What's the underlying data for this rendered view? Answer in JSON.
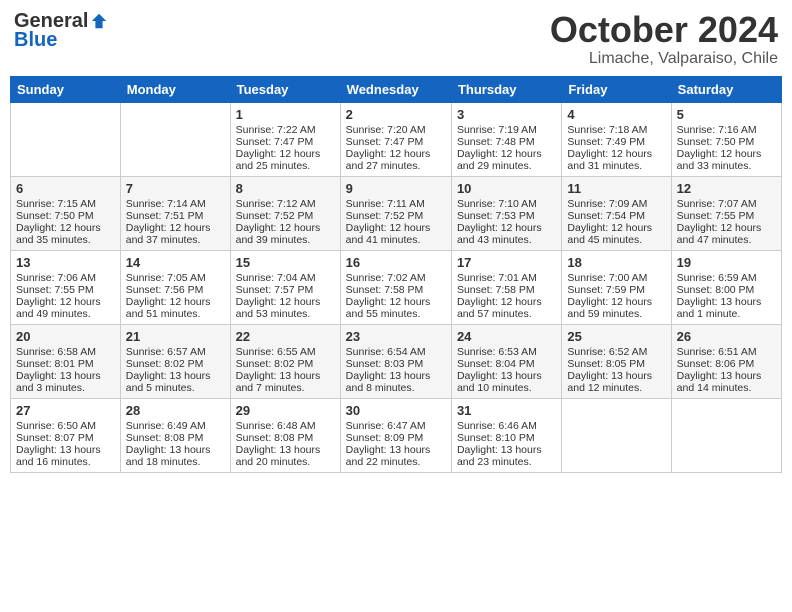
{
  "header": {
    "logo_general": "General",
    "logo_blue": "Blue",
    "title": "October 2024",
    "subtitle": "Limache, Valparaiso, Chile"
  },
  "days_of_week": [
    "Sunday",
    "Monday",
    "Tuesday",
    "Wednesday",
    "Thursday",
    "Friday",
    "Saturday"
  ],
  "weeks": [
    [
      {
        "day": "",
        "sunrise": "",
        "sunset": "",
        "daylight": ""
      },
      {
        "day": "",
        "sunrise": "",
        "sunset": "",
        "daylight": ""
      },
      {
        "day": "1",
        "sunrise": "Sunrise: 7:22 AM",
        "sunset": "Sunset: 7:47 PM",
        "daylight": "Daylight: 12 hours and 25 minutes."
      },
      {
        "day": "2",
        "sunrise": "Sunrise: 7:20 AM",
        "sunset": "Sunset: 7:47 PM",
        "daylight": "Daylight: 12 hours and 27 minutes."
      },
      {
        "day": "3",
        "sunrise": "Sunrise: 7:19 AM",
        "sunset": "Sunset: 7:48 PM",
        "daylight": "Daylight: 12 hours and 29 minutes."
      },
      {
        "day": "4",
        "sunrise": "Sunrise: 7:18 AM",
        "sunset": "Sunset: 7:49 PM",
        "daylight": "Daylight: 12 hours and 31 minutes."
      },
      {
        "day": "5",
        "sunrise": "Sunrise: 7:16 AM",
        "sunset": "Sunset: 7:50 PM",
        "daylight": "Daylight: 12 hours and 33 minutes."
      }
    ],
    [
      {
        "day": "6",
        "sunrise": "Sunrise: 7:15 AM",
        "sunset": "Sunset: 7:50 PM",
        "daylight": "Daylight: 12 hours and 35 minutes."
      },
      {
        "day": "7",
        "sunrise": "Sunrise: 7:14 AM",
        "sunset": "Sunset: 7:51 PM",
        "daylight": "Daylight: 12 hours and 37 minutes."
      },
      {
        "day": "8",
        "sunrise": "Sunrise: 7:12 AM",
        "sunset": "Sunset: 7:52 PM",
        "daylight": "Daylight: 12 hours and 39 minutes."
      },
      {
        "day": "9",
        "sunrise": "Sunrise: 7:11 AM",
        "sunset": "Sunset: 7:52 PM",
        "daylight": "Daylight: 12 hours and 41 minutes."
      },
      {
        "day": "10",
        "sunrise": "Sunrise: 7:10 AM",
        "sunset": "Sunset: 7:53 PM",
        "daylight": "Daylight: 12 hours and 43 minutes."
      },
      {
        "day": "11",
        "sunrise": "Sunrise: 7:09 AM",
        "sunset": "Sunset: 7:54 PM",
        "daylight": "Daylight: 12 hours and 45 minutes."
      },
      {
        "day": "12",
        "sunrise": "Sunrise: 7:07 AM",
        "sunset": "Sunset: 7:55 PM",
        "daylight": "Daylight: 12 hours and 47 minutes."
      }
    ],
    [
      {
        "day": "13",
        "sunrise": "Sunrise: 7:06 AM",
        "sunset": "Sunset: 7:55 PM",
        "daylight": "Daylight: 12 hours and 49 minutes."
      },
      {
        "day": "14",
        "sunrise": "Sunrise: 7:05 AM",
        "sunset": "Sunset: 7:56 PM",
        "daylight": "Daylight: 12 hours and 51 minutes."
      },
      {
        "day": "15",
        "sunrise": "Sunrise: 7:04 AM",
        "sunset": "Sunset: 7:57 PM",
        "daylight": "Daylight: 12 hours and 53 minutes."
      },
      {
        "day": "16",
        "sunrise": "Sunrise: 7:02 AM",
        "sunset": "Sunset: 7:58 PM",
        "daylight": "Daylight: 12 hours and 55 minutes."
      },
      {
        "day": "17",
        "sunrise": "Sunrise: 7:01 AM",
        "sunset": "Sunset: 7:58 PM",
        "daylight": "Daylight: 12 hours and 57 minutes."
      },
      {
        "day": "18",
        "sunrise": "Sunrise: 7:00 AM",
        "sunset": "Sunset: 7:59 PM",
        "daylight": "Daylight: 12 hours and 59 minutes."
      },
      {
        "day": "19",
        "sunrise": "Sunrise: 6:59 AM",
        "sunset": "Sunset: 8:00 PM",
        "daylight": "Daylight: 13 hours and 1 minute."
      }
    ],
    [
      {
        "day": "20",
        "sunrise": "Sunrise: 6:58 AM",
        "sunset": "Sunset: 8:01 PM",
        "daylight": "Daylight: 13 hours and 3 minutes."
      },
      {
        "day": "21",
        "sunrise": "Sunrise: 6:57 AM",
        "sunset": "Sunset: 8:02 PM",
        "daylight": "Daylight: 13 hours and 5 minutes."
      },
      {
        "day": "22",
        "sunrise": "Sunrise: 6:55 AM",
        "sunset": "Sunset: 8:02 PM",
        "daylight": "Daylight: 13 hours and 7 minutes."
      },
      {
        "day": "23",
        "sunrise": "Sunrise: 6:54 AM",
        "sunset": "Sunset: 8:03 PM",
        "daylight": "Daylight: 13 hours and 8 minutes."
      },
      {
        "day": "24",
        "sunrise": "Sunrise: 6:53 AM",
        "sunset": "Sunset: 8:04 PM",
        "daylight": "Daylight: 13 hours and 10 minutes."
      },
      {
        "day": "25",
        "sunrise": "Sunrise: 6:52 AM",
        "sunset": "Sunset: 8:05 PM",
        "daylight": "Daylight: 13 hours and 12 minutes."
      },
      {
        "day": "26",
        "sunrise": "Sunrise: 6:51 AM",
        "sunset": "Sunset: 8:06 PM",
        "daylight": "Daylight: 13 hours and 14 minutes."
      }
    ],
    [
      {
        "day": "27",
        "sunrise": "Sunrise: 6:50 AM",
        "sunset": "Sunset: 8:07 PM",
        "daylight": "Daylight: 13 hours and 16 minutes."
      },
      {
        "day": "28",
        "sunrise": "Sunrise: 6:49 AM",
        "sunset": "Sunset: 8:08 PM",
        "daylight": "Daylight: 13 hours and 18 minutes."
      },
      {
        "day": "29",
        "sunrise": "Sunrise: 6:48 AM",
        "sunset": "Sunset: 8:08 PM",
        "daylight": "Daylight: 13 hours and 20 minutes."
      },
      {
        "day": "30",
        "sunrise": "Sunrise: 6:47 AM",
        "sunset": "Sunset: 8:09 PM",
        "daylight": "Daylight: 13 hours and 22 minutes."
      },
      {
        "day": "31",
        "sunrise": "Sunrise: 6:46 AM",
        "sunset": "Sunset: 8:10 PM",
        "daylight": "Daylight: 13 hours and 23 minutes."
      },
      {
        "day": "",
        "sunrise": "",
        "sunset": "",
        "daylight": ""
      },
      {
        "day": "",
        "sunrise": "",
        "sunset": "",
        "daylight": ""
      }
    ]
  ]
}
